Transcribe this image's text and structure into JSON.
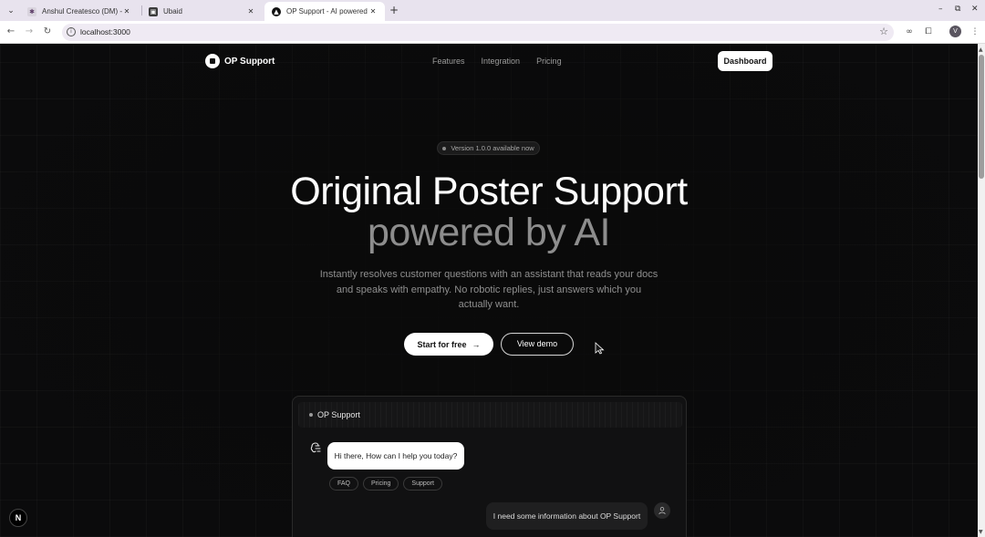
{
  "browser": {
    "tabs": [
      {
        "title": "Anshul Createsco (DM) - Cr",
        "close": "✕"
      },
      {
        "title": "Ubaid",
        "close": "✕"
      },
      {
        "title": "OP Support - AI powered cu",
        "close": "✕"
      }
    ],
    "new_tab": "+",
    "url": "localhost:3000",
    "profile_initial": "V",
    "window_controls": {
      "minimize": "–",
      "maximize": "⧉",
      "close": "✕"
    }
  },
  "nav": {
    "brand": "OP Support",
    "links": [
      "Features",
      "Integration",
      "Pricing"
    ],
    "dashboard_label": "Dashboard"
  },
  "hero": {
    "badge": "Version 1.0.0 available now",
    "title_line1": "Original Poster Support",
    "title_line2": "powered by AI",
    "subtitle": "Instantly resolves customer questions with an assistant that reads your docs and speaks with empathy. No robotic replies, just answers which you actually want.",
    "primary_cta": "Start for free",
    "primary_cta_arrow": "→",
    "secondary_cta": "View demo"
  },
  "chat_preview": {
    "header": "OP Support",
    "bot_message": "Hi there, How can I help you today?",
    "quick_replies": [
      "FAQ",
      "Pricing",
      "Support"
    ],
    "user_message": "I need some information about OP Support"
  },
  "dev_badge": "N",
  "colors": {
    "page_bg": "#0a0a0a",
    "accent": "#ffffff",
    "muted_text": "#8d8d8d"
  }
}
